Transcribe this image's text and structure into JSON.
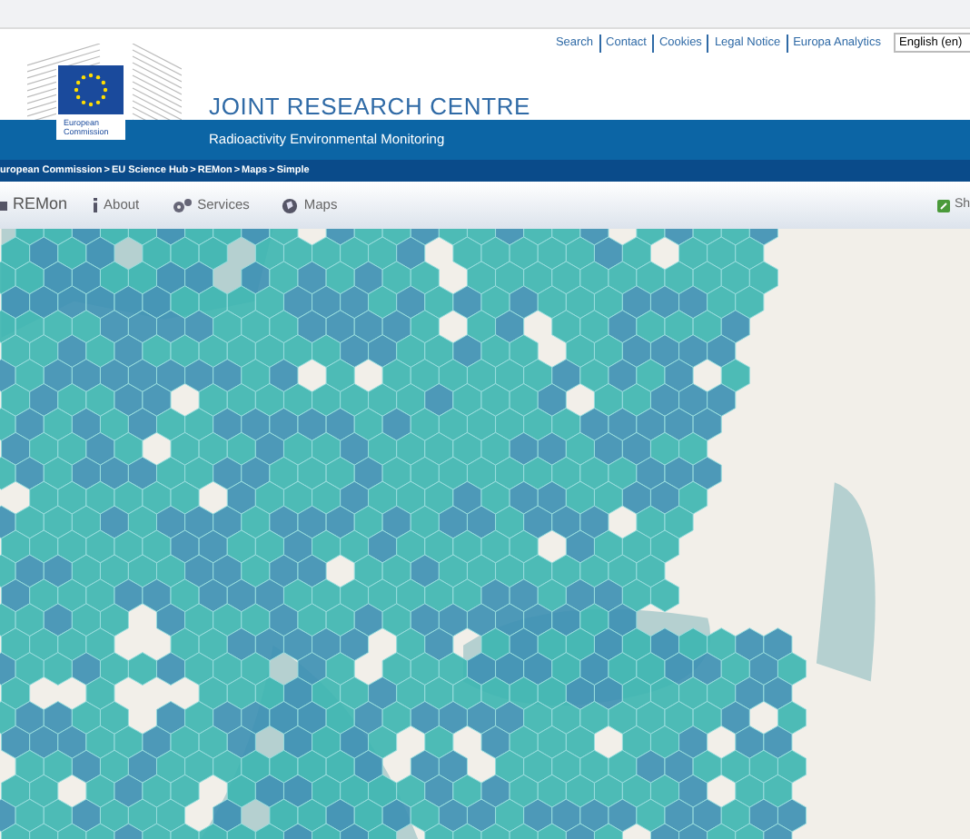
{
  "top_links": [
    "Search",
    "Contact",
    "Cookies",
    "Legal Notice",
    "Europa Analytics"
  ],
  "language": {
    "value": "English (en)"
  },
  "logo": {
    "caption": "European Commission"
  },
  "site_title": "JOINT RESEARCH CENTRE",
  "subtitle": "Radioactivity Environmental Monitoring",
  "breadcrumb": {
    "separator": ">",
    "items": [
      "uropean Commission",
      "EU Science Hub",
      "REMon",
      "Maps",
      "Simple"
    ]
  },
  "nav": {
    "brand": "REMon",
    "items": [
      {
        "label": "About",
        "kind": "info"
      },
      {
        "label": "Services",
        "kind": "gears"
      },
      {
        "label": "Maps",
        "kind": "globe"
      }
    ],
    "right": "Sh"
  }
}
